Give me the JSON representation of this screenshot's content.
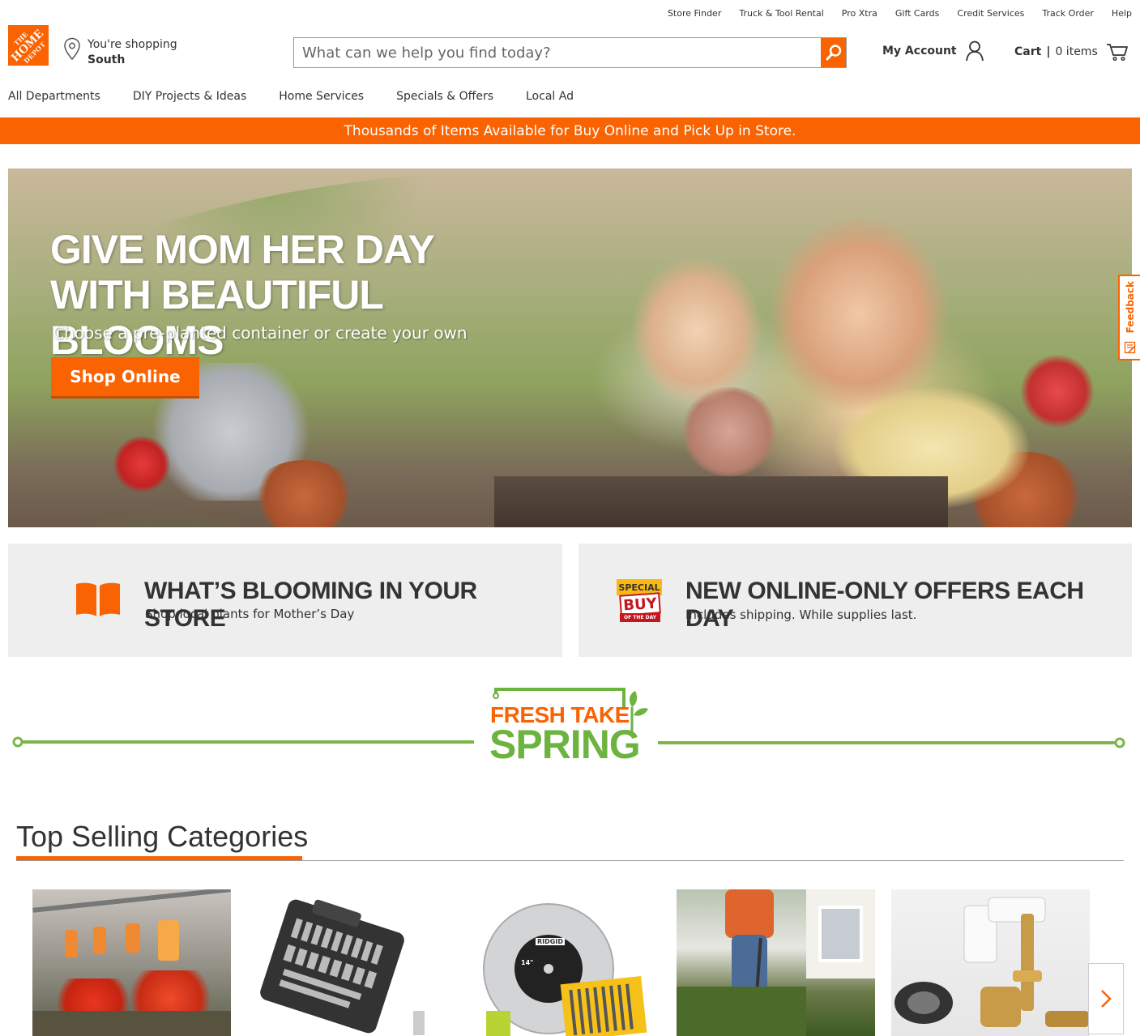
{
  "utility_links": [
    "Store Finder",
    "Truck & Tool Rental",
    "Pro Xtra",
    "Gift Cards",
    "Credit Services",
    "Track Order",
    "Help"
  ],
  "logo": {
    "line1": "THE",
    "line2": "HOME",
    "line3": "DEPOT"
  },
  "store": {
    "label": "You're shopping",
    "name": "South"
  },
  "search": {
    "placeholder": "What can we help you find today?"
  },
  "account": {
    "label": "My Account"
  },
  "cart": {
    "label": "Cart",
    "separator": "|",
    "count": "0 items"
  },
  "nav": [
    "All Departments",
    "DIY Projects & Ideas",
    "Home Services",
    "Specials & Offers",
    "Local Ad"
  ],
  "promo": "Thousands of Items Available for Buy Online and Pick Up in Store.",
  "hero": {
    "headline_1": "GIVE MOM HER DAY",
    "headline_2": "WITH BEAUTIFUL BLOOMS",
    "subtitle": "Choose a pre-planted container or create your own",
    "cta": "Shop Online"
  },
  "feedback": "Feedback",
  "tiles": [
    {
      "title": "WHAT’S BLOOMING IN YOUR STORE",
      "subtitle": "Shop local plants for Mother’s Day"
    },
    {
      "title": "NEW ONLINE-ONLY OFFERS EACH DAY",
      "subtitle": "Includes shipping. While supplies last.",
      "badge_1": "SPECIAL",
      "badge_2": "BUY",
      "badge_3": "OF THE DAY"
    }
  ],
  "fresh_take": {
    "line1": "FRESH TAKE",
    "line2": "SPRING"
  },
  "top_selling": {
    "title": "Top Selling Categories",
    "categories": [
      "hanging-flowers",
      "socket-set",
      "saw-blade-drill-bits",
      "string-trimmer",
      "plumbing-fittings"
    ],
    "saw_brand": "RIDGID",
    "saw_size": "14\""
  },
  "colors": {
    "brand": "#f96302",
    "green": "#6cb33f"
  }
}
